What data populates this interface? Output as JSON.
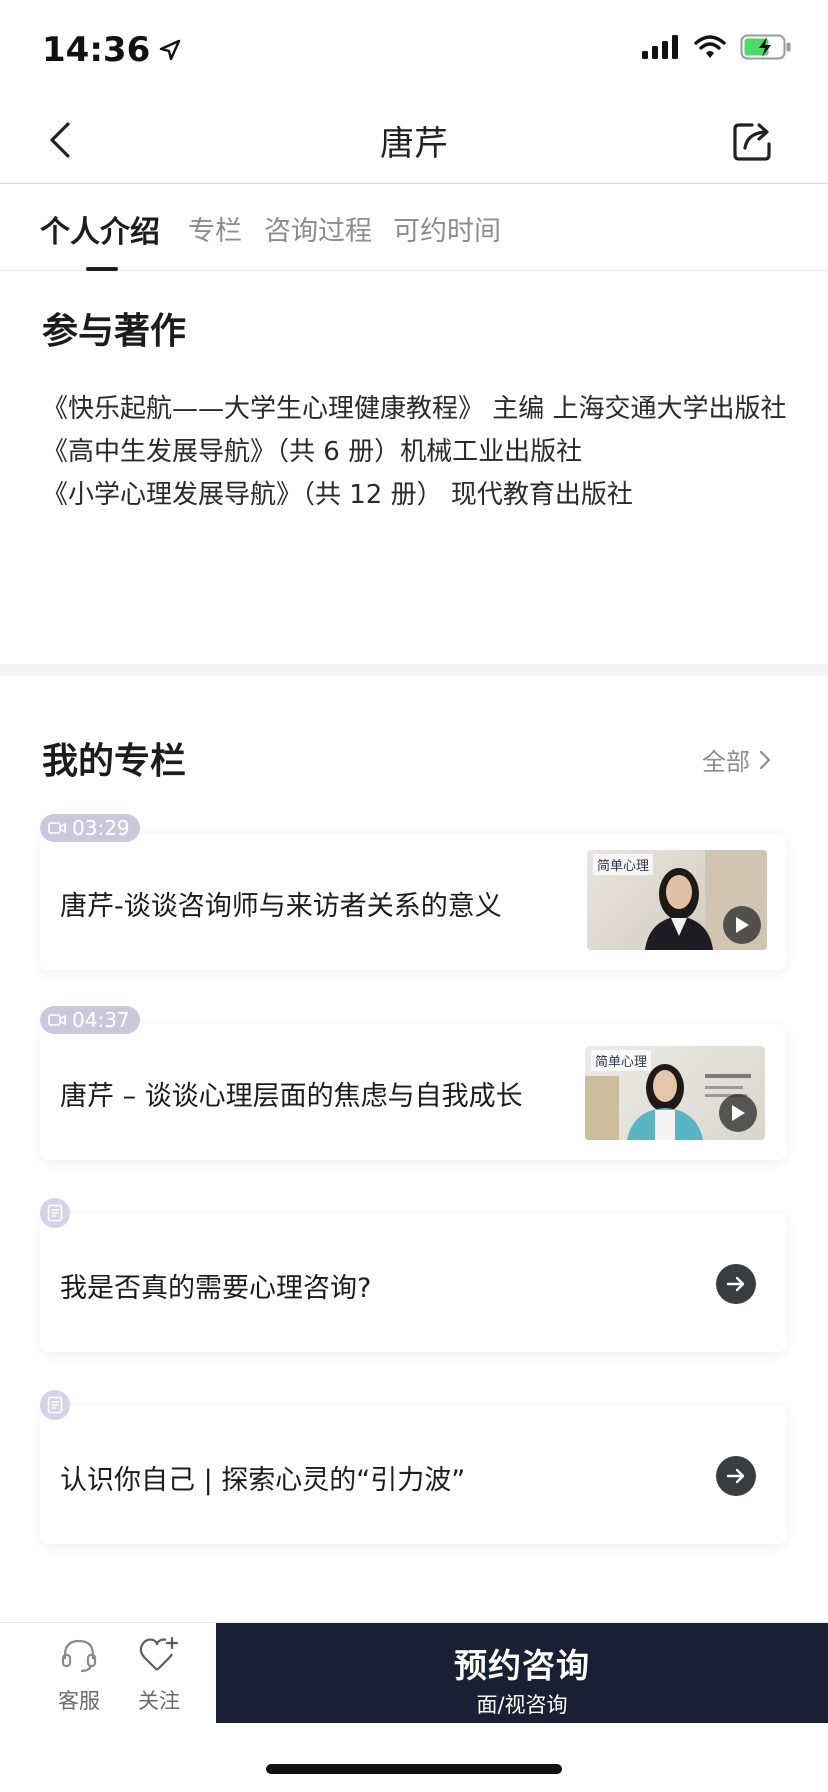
{
  "status_bar": {
    "time": "14:36"
  },
  "nav": {
    "title": "唐芹"
  },
  "tabs": [
    {
      "label": "个人介绍",
      "active": true
    },
    {
      "label": "专栏",
      "active": false
    },
    {
      "label": "咨询过程",
      "active": false
    },
    {
      "label": "可约时间",
      "active": false
    }
  ],
  "works": {
    "title": "参与著作",
    "lines": [
      "《快乐起航——大学生心理健康教程》 主编  上海交通大学出版社",
      "《高中生发展导航》（共 6 册）机械工业出版社",
      "《小学心理发展导航》（共 12 册） 现代教育出版社"
    ]
  },
  "column": {
    "title": "我的专栏",
    "see_all": "全部",
    "items": [
      {
        "type": "video",
        "duration": "03:29",
        "title": "唐芹-谈谈咨询师与来访者关系的意义",
        "thumb_logo": "简单心理"
      },
      {
        "type": "video",
        "duration": "04:37",
        "title": "唐芹 – 谈谈心理层面的焦虑与自我成长",
        "thumb_logo": "简单心理"
      },
      {
        "type": "article",
        "title": "我是否真的需要心理咨询?"
      },
      {
        "type": "article",
        "title": "认识你自己 | 探索心灵的“引力波”"
      }
    ]
  },
  "bottom_bar": {
    "service_label": "客服",
    "follow_label": "关注",
    "book_label": "预约咨询",
    "book_sub": "面/视咨询"
  },
  "colors": {
    "primary_dark": "#1b1f33",
    "badge": "#c9c9dd",
    "text_primary": "#1c1c1c",
    "text_secondary": "#8d8d8d",
    "battery_green": "#4cd964"
  },
  "icons": [
    "back-icon",
    "share-icon",
    "video-icon",
    "document-icon",
    "play-icon",
    "arrow-right-icon",
    "headset-icon",
    "heart-plus-icon"
  ]
}
